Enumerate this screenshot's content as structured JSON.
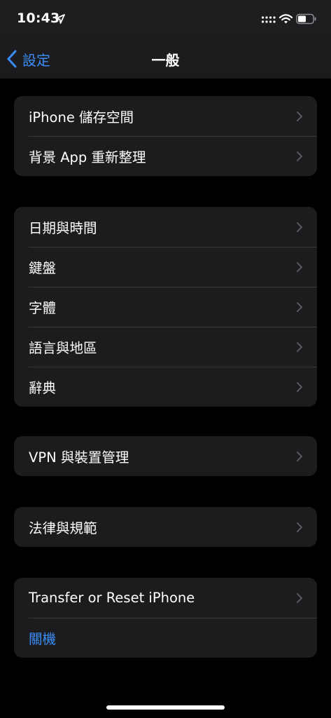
{
  "status_bar": {
    "time": "10:43"
  },
  "nav": {
    "back_label": "設定",
    "title": "一般"
  },
  "groups": [
    {
      "items": [
        {
          "label": "iPhone 儲存空間"
        },
        {
          "label": "背景 App 重新整理"
        }
      ]
    },
    {
      "items": [
        {
          "label": "日期與時間"
        },
        {
          "label": "鍵盤"
        },
        {
          "label": "字體"
        },
        {
          "label": "語言與地區"
        },
        {
          "label": "辭典"
        }
      ]
    },
    {
      "items": [
        {
          "label": "VPN 與裝置管理"
        }
      ]
    },
    {
      "items": [
        {
          "label": "法律與規範"
        }
      ]
    },
    {
      "items": [
        {
          "label": "Transfer or Reset iPhone"
        },
        {
          "label": "關機"
        }
      ]
    }
  ],
  "colors": {
    "accent": "#3a8df5",
    "background": "#000000",
    "group_background": "#1c1c1e",
    "separator": "#38383a",
    "chevron": "#5a5a5e"
  }
}
